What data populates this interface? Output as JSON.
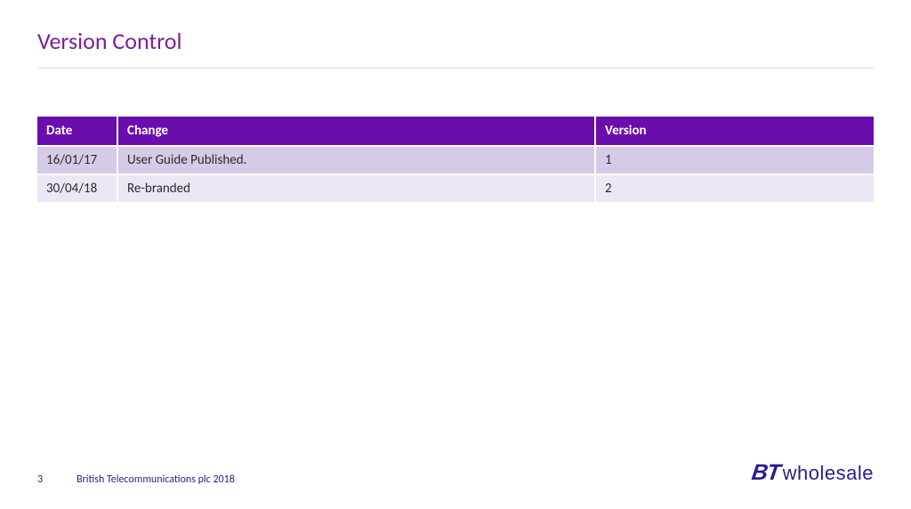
{
  "title": "Version Control",
  "table": {
    "headers": {
      "date": "Date",
      "change": "Change",
      "version": "Version"
    },
    "rows": [
      {
        "date": "16/01/17",
        "change": "User Guide Published.",
        "version": "1"
      },
      {
        "date": "30/04/18",
        "change": "Re-branded",
        "version": "2"
      }
    ]
  },
  "footer": {
    "page": "3",
    "copyright": "British Telecommunications plc 2018",
    "logo_bt": "BT",
    "logo_wholesale": "wholesale"
  }
}
